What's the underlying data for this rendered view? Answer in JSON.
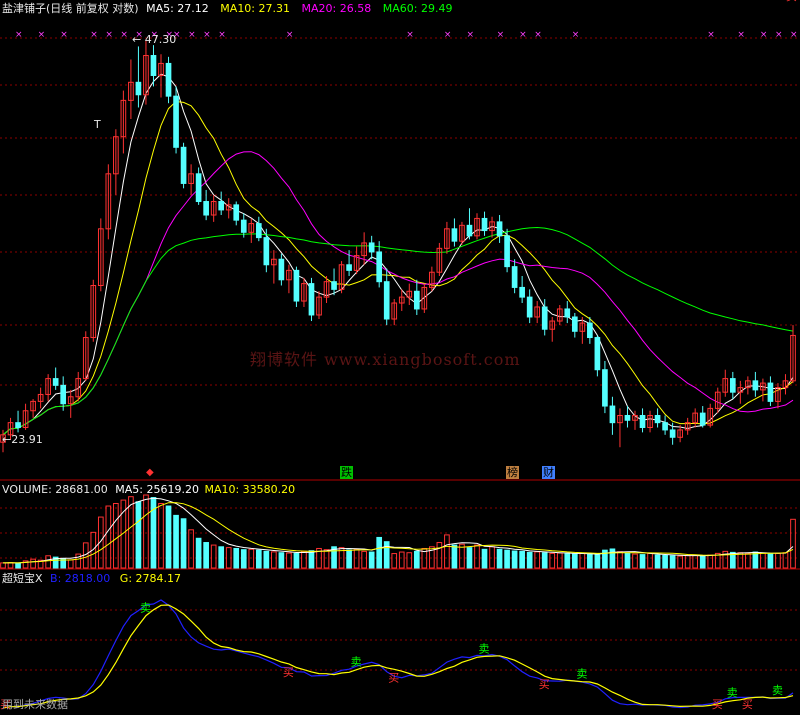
{
  "header": {
    "title": "盐津铺子(日线 前复权 对数)",
    "ma5_label": "MA5: 27.12",
    "ma10_label": "MA10: 27.31",
    "ma20_label": "MA20: 26.58",
    "ma60_label": "MA60: 29.49"
  },
  "price_annotations": {
    "high": "47.30",
    "low": "23.91",
    "t_marker": "T"
  },
  "event_markers": [
    "跌",
    "榜",
    "财"
  ],
  "volume_header": {
    "volume_label": "VOLUME: 28681.00",
    "ma5_label": "MA5: 25619.20",
    "ma10_label": "MA10: 33580.20"
  },
  "indicator_header": {
    "name": "超短宝X",
    "b_label": "B: 2818.00",
    "g_label": "G: 2784.17"
  },
  "indicator_footer": "用到未来数据",
  "watermark": "翔博软件 www.xiangbosoft.com",
  "buy_label": "买",
  "sell_label": "卖",
  "colors": {
    "background": "#000000",
    "up": "#ff3232",
    "down": "#54ffff",
    "ma5": "#ffffff",
    "ma10": "#ffff00",
    "ma20": "#ff00ff",
    "ma60": "#00ff00",
    "indicator_b": "#2020ff",
    "indicator_g": "#ffff00",
    "grid": "#8b0000"
  },
  "chart_data": {
    "type": "candlestick",
    "scale": "log",
    "price_high": 47.3,
    "price_low": 23.91,
    "candles_ohlc": [
      [
        24.3,
        24.8,
        23.9,
        24.6
      ],
      [
        24.6,
        25.3,
        24.4,
        25.1
      ],
      [
        25.1,
        25.6,
        24.7,
        24.9
      ],
      [
        24.9,
        25.9,
        24.8,
        25.6
      ],
      [
        25.6,
        26.1,
        25.3,
        26.0
      ],
      [
        26.0,
        26.6,
        25.7,
        26.3
      ],
      [
        26.3,
        27.2,
        26.0,
        27.0
      ],
      [
        27.0,
        27.5,
        26.5,
        26.7
      ],
      [
        26.7,
        27.1,
        25.6,
        25.9
      ],
      [
        25.9,
        26.5,
        25.3,
        26.2
      ],
      [
        26.2,
        27.3,
        26.0,
        27.0
      ],
      [
        27.0,
        29.2,
        26.9,
        28.9
      ],
      [
        28.9,
        31.8,
        28.7,
        31.5
      ],
      [
        31.5,
        35.2,
        31.2,
        34.6
      ],
      [
        34.6,
        38.5,
        34.0,
        37.9
      ],
      [
        37.9,
        40.8,
        36.6,
        40.3
      ],
      [
        40.3,
        43.5,
        39.2,
        42.8
      ],
      [
        42.8,
        45.8,
        41.5,
        44.1
      ],
      [
        44.1,
        46.8,
        42.3,
        43.2
      ],
      [
        43.2,
        47.3,
        42.5,
        46.1
      ],
      [
        46.1,
        46.9,
        43.8,
        44.6
      ],
      [
        44.6,
        46.2,
        43.0,
        45.5
      ],
      [
        45.5,
        46.0,
        42.6,
        43.1
      ],
      [
        43.1,
        43.8,
        39.2,
        39.6
      ],
      [
        39.6,
        39.9,
        37.0,
        37.3
      ],
      [
        37.3,
        38.5,
        36.6,
        37.9
      ],
      [
        37.9,
        38.3,
        36.0,
        36.2
      ],
      [
        36.2,
        36.9,
        35.1,
        35.4
      ],
      [
        35.4,
        36.6,
        35.0,
        36.2
      ],
      [
        36.2,
        36.8,
        35.4,
        35.7
      ],
      [
        35.7,
        36.4,
        35.2,
        36.0
      ],
      [
        36.0,
        36.2,
        34.8,
        35.1
      ],
      [
        35.1,
        35.5,
        34.1,
        34.4
      ],
      [
        34.4,
        35.2,
        33.8,
        34.9
      ],
      [
        34.9,
        35.3,
        33.9,
        34.1
      ],
      [
        34.1,
        34.6,
        32.2,
        32.6
      ],
      [
        32.6,
        33.4,
        31.6,
        32.9
      ],
      [
        32.9,
        33.2,
        31.5,
        31.8
      ],
      [
        31.8,
        32.6,
        31.1,
        32.3
      ],
      [
        32.3,
        32.5,
        30.4,
        30.7
      ],
      [
        30.7,
        31.9,
        30.4,
        31.6
      ],
      [
        31.6,
        31.9,
        29.7,
        30.0
      ],
      [
        30.0,
        31.2,
        29.8,
        30.9
      ],
      [
        30.9,
        32.0,
        30.6,
        31.7
      ],
      [
        31.7,
        32.4,
        31.0,
        31.3
      ],
      [
        31.3,
        32.8,
        31.1,
        32.6
      ],
      [
        32.6,
        33.4,
        32.0,
        32.3
      ],
      [
        32.3,
        33.6,
        32.1,
        33.1
      ],
      [
        33.1,
        34.4,
        32.6,
        33.8
      ],
      [
        33.8,
        34.2,
        32.9,
        33.3
      ],
      [
        33.3,
        33.9,
        31.4,
        31.7
      ],
      [
        31.7,
        32.4,
        29.5,
        29.8
      ],
      [
        29.8,
        30.8,
        29.5,
        30.6
      ],
      [
        30.6,
        31.3,
        30.2,
        30.9
      ],
      [
        30.9,
        31.6,
        30.5,
        31.2
      ],
      [
        31.2,
        31.8,
        30.0,
        30.3
      ],
      [
        30.3,
        31.6,
        30.1,
        31.4
      ],
      [
        31.4,
        32.5,
        31.2,
        32.2
      ],
      [
        32.2,
        33.8,
        32.0,
        33.5
      ],
      [
        33.5,
        35.0,
        33.2,
        34.6
      ],
      [
        34.6,
        35.2,
        33.6,
        33.9
      ],
      [
        33.9,
        35.0,
        33.7,
        34.8
      ],
      [
        34.8,
        35.8,
        34.0,
        34.2
      ],
      [
        34.2,
        35.5,
        34.0,
        35.2
      ],
      [
        35.2,
        35.6,
        34.2,
        34.5
      ],
      [
        34.5,
        35.3,
        34.1,
        35.0
      ],
      [
        35.0,
        35.4,
        33.8,
        34.2
      ],
      [
        34.2,
        34.6,
        32.2,
        32.5
      ],
      [
        32.5,
        32.9,
        31.1,
        31.4
      ],
      [
        31.4,
        32.0,
        30.6,
        30.9
      ],
      [
        30.9,
        31.3,
        29.6,
        29.9
      ],
      [
        29.9,
        30.7,
        29.6,
        30.4
      ],
      [
        30.4,
        30.8,
        29.0,
        29.3
      ],
      [
        29.3,
        29.9,
        28.7,
        29.7
      ],
      [
        29.7,
        30.5,
        29.5,
        30.3
      ],
      [
        30.3,
        30.7,
        29.6,
        29.9
      ],
      [
        29.9,
        30.1,
        28.9,
        29.2
      ],
      [
        29.2,
        29.9,
        28.6,
        29.6
      ],
      [
        29.6,
        29.9,
        28.6,
        28.9
      ],
      [
        28.9,
        29.0,
        27.1,
        27.4
      ],
      [
        27.4,
        27.8,
        25.5,
        25.8
      ],
      [
        25.8,
        26.2,
        24.6,
        25.1
      ],
      [
        25.1,
        25.7,
        24.1,
        25.4
      ],
      [
        25.4,
        25.8,
        24.9,
        25.2
      ],
      [
        25.2,
        25.6,
        24.8,
        25.4
      ],
      [
        25.4,
        25.7,
        24.7,
        24.9
      ],
      [
        24.9,
        25.6,
        24.7,
        25.4
      ],
      [
        25.4,
        25.7,
        24.9,
        25.1
      ],
      [
        25.1,
        25.4,
        24.6,
        24.8
      ],
      [
        24.8,
        25.1,
        24.2,
        24.5
      ],
      [
        24.5,
        25.0,
        24.3,
        24.8
      ],
      [
        24.8,
        25.3,
        24.6,
        25.1
      ],
      [
        25.1,
        25.7,
        24.9,
        25.5
      ],
      [
        25.5,
        25.8,
        24.9,
        25.0
      ],
      [
        25.0,
        25.9,
        24.9,
        25.7
      ],
      [
        25.7,
        26.6,
        25.5,
        26.4
      ],
      [
        26.4,
        27.4,
        26.2,
        27.0
      ],
      [
        27.0,
        27.3,
        26.1,
        26.4
      ],
      [
        26.4,
        26.9,
        25.9,
        26.6
      ],
      [
        26.6,
        27.1,
        26.3,
        26.9
      ],
      [
        26.9,
        27.3,
        26.2,
        26.5
      ],
      [
        26.5,
        27.0,
        26.0,
        26.8
      ],
      [
        26.8,
        27.1,
        25.8,
        26.0
      ],
      [
        26.0,
        26.8,
        25.7,
        26.6
      ],
      [
        26.6,
        27.2,
        26.3,
        26.9
      ],
      [
        26.9,
        29.5,
        26.8,
        29.0
      ]
    ],
    "volume": [
      3000,
      3200,
      2800,
      4200,
      5200,
      4600,
      7200,
      6400,
      5600,
      4800,
      8200,
      14800,
      21000,
      30000,
      36500,
      38000,
      40000,
      42000,
      39000,
      43000,
      41500,
      38000,
      36500,
      31000,
      29000,
      22500,
      17500,
      15000,
      13500,
      12500,
      12000,
      11500,
      10800,
      11000,
      10500,
      9800,
      9500,
      9000,
      8800,
      8600,
      9800,
      10200,
      11500,
      10800,
      12500,
      12000,
      10600,
      11000,
      9800,
      9400,
      18000,
      15500,
      8500,
      9400,
      9000,
      9800,
      11500,
      12500,
      15000,
      19500,
      13500,
      14000,
      12000,
      13500,
      11000,
      12500,
      11000,
      10500,
      10000,
      9800,
      9200,
      9500,
      9000,
      8600,
      8800,
      8400,
      8200,
      8600,
      8000,
      7800,
      10500,
      11200,
      9600,
      8800,
      8200,
      7900,
      8600,
      7600,
      7400,
      7200,
      7000,
      7300,
      7600,
      7200,
      7600,
      8600,
      9800,
      9200,
      9000,
      8600,
      9400,
      8800,
      8200,
      8600,
      9000,
      28681
    ],
    "markers": [
      {
        "label": "买",
        "index": 0
      },
      {
        "label": "卖",
        "index": 19
      },
      {
        "label": "买",
        "index": 38
      },
      {
        "label": "卖",
        "index": 47
      },
      {
        "label": "买",
        "index": 52
      },
      {
        "label": "卖",
        "index": 64
      },
      {
        "label": "买",
        "index": 72
      },
      {
        "label": "卖",
        "index": 77
      },
      {
        "label": "买",
        "index": 95
      },
      {
        "label": "卖",
        "index": 97
      },
      {
        "label": "买",
        "index": 99
      },
      {
        "label": "卖",
        "index": 103
      },
      {
        "label": "买",
        "index": 106
      }
    ]
  }
}
